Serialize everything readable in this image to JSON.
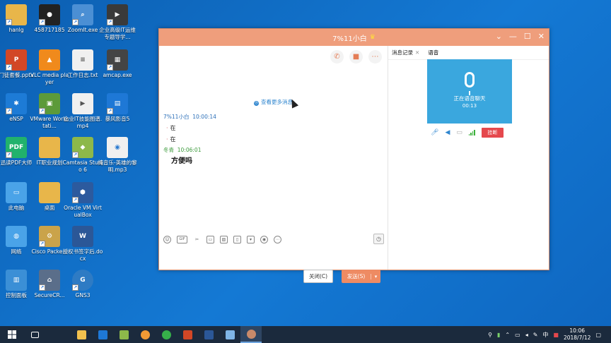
{
  "desktop_icons": [
    {
      "label": "hanlg",
      "icon": "folder-user-icon",
      "color": "#e8b64a"
    },
    {
      "label": "458717185",
      "icon": "qq-penguin-icon",
      "color": "#222222"
    },
    {
      "label": "ZoomIt.exe",
      "icon": "zoomit-icon",
      "color": "#4b8fd4"
    },
    {
      "label": "企业高级IT运维专题导学...",
      "icon": "video-file-icon",
      "color": "#3a3a3a"
    },
    {
      "label": "门徒套餐.pptx",
      "icon": "pptx-file-icon",
      "color": "#d24726"
    },
    {
      "label": "VLC media player",
      "icon": "vlc-cone-icon",
      "color": "#f08a1c"
    },
    {
      "label": "工作日志.txt",
      "icon": "text-file-icon",
      "color": "#f0f0f0"
    },
    {
      "label": "amcap.exe",
      "icon": "amcap-icon",
      "color": "#444444"
    },
    {
      "label": "eNSP",
      "icon": "ensp-icon",
      "color": "#1d7bd6"
    },
    {
      "label": "VMware Workstati...",
      "icon": "vmware-icon",
      "color": "#5c9a3a"
    },
    {
      "label": "企业IT技能图谱.mp4",
      "icon": "mp4-file-icon",
      "color": "#f0f0f0"
    },
    {
      "label": "暴风影音5",
      "icon": "storm-player-icon",
      "color": "#1e78d6"
    },
    {
      "label": "迅读PDF大师",
      "icon": "pdf-reader-icon",
      "color": "#21b26c"
    },
    {
      "label": "IT职业规划",
      "icon": "folder-icon",
      "color": "#e8b64a"
    },
    {
      "label": "Camtasia Studio 6",
      "icon": "camtasia-icon",
      "color": "#8db84a"
    },
    {
      "label": "纯音乐-英雄的黎明.mp3",
      "icon": "mp3-file-icon",
      "color": "#f0f0f0"
    },
    {
      "label": "此电脑",
      "icon": "computer-icon",
      "color": "#4aa3e8"
    },
    {
      "label": "桌面",
      "icon": "folder-icon",
      "color": "#e8b64a"
    },
    {
      "label": "Oracle VM VirtualBox",
      "icon": "virtualbox-icon",
      "color": "#2c5a9e"
    },
    {
      "label": "网络",
      "icon": "network-icon",
      "color": "#4aa3e8"
    },
    {
      "label": "Cisco Packe...",
      "icon": "cisco-packet-tracer-icon",
      "color": "#caa34a"
    },
    {
      "label": "授权书签字后.docx",
      "icon": "docx-file-icon",
      "color": "#2b5797"
    },
    {
      "label": "控制面板",
      "icon": "control-panel-icon",
      "color": "#3b8fd6"
    },
    {
      "label": "SecureCR...",
      "icon": "securecrt-icon",
      "color": "#5a6e8a"
    },
    {
      "label": "GNS3",
      "icon": "gns3-icon",
      "color": "#2e7bc4"
    }
  ],
  "chat_window": {
    "title": "7%11小白",
    "title_icon": "crown-icon",
    "more_messages": "查看更多消息",
    "messages": [
      {
        "sender": "7%11小白",
        "time": "10:00:14",
        "lines": [
          "在",
          "在"
        ]
      },
      {
        "sender": "冬青",
        "time": "10:06:01",
        "text": "方便吗"
      }
    ],
    "toolbar_icons": [
      "emoji-icon",
      "gif-icon",
      "scissors-icon",
      "folder-icon",
      "image-icon",
      "phone-shake-icon",
      "trash-icon",
      "red-packet-icon",
      "more-icon"
    ],
    "gif_label": "GIF",
    "close_label": "关闭(C)",
    "send_label": "发送(S)"
  },
  "right_panel": {
    "tabs": [
      {
        "label": "消息记录",
        "closable": true
      },
      {
        "label": "语音",
        "closable": false
      }
    ],
    "voice_status": "正在语音聊天",
    "voice_timer": "00:13",
    "hangup_label": "挂断"
  },
  "taskbar": {
    "apps": [
      {
        "icon": "task-view-icon",
        "color": "#ffffff"
      },
      {
        "icon": "file-explorer-icon",
        "color": "#f2c14e"
      },
      {
        "icon": "storm-player-icon",
        "color": "#1e78d6"
      },
      {
        "icon": "camtasia-icon",
        "color": "#8db84a"
      },
      {
        "icon": "software-icon",
        "color": "#f29a35"
      },
      {
        "icon": "qihoo-browser-icon",
        "color": "#36b04a"
      },
      {
        "icon": "powerpoint-icon",
        "color": "#d24726"
      },
      {
        "icon": "word-icon",
        "color": "#2b5797"
      },
      {
        "icon": "notepad-icon",
        "color": "#7fb5e6"
      },
      {
        "icon": "qq-avatar-icon",
        "color": "#c98a6a"
      }
    ],
    "ime_label": "中",
    "clock_time": "10:06",
    "clock_date": "2018/7/12"
  },
  "colors": {
    "desktop": "#1270c9",
    "title_bar": "#ef9e7c",
    "send_button": "#ee8b63",
    "voice_card": "#3aa7de",
    "hangup": "#e5484d"
  }
}
